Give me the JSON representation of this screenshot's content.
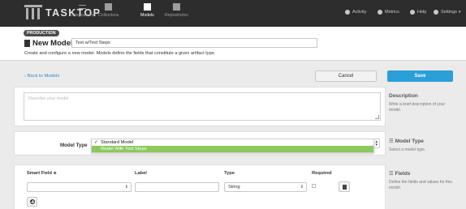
{
  "brand": {
    "name": "TASKTOP"
  },
  "nav": {
    "items": [
      {
        "label": "Integrations"
      },
      {
        "label": "Collections"
      },
      {
        "label": "Models"
      },
      {
        "label": "Repositories"
      }
    ],
    "right": [
      {
        "label": "Activity",
        "icon": "bell-icon"
      },
      {
        "label": "Metrics",
        "icon": "dashboard-icon"
      },
      {
        "label": "Help",
        "icon": "help-icon"
      },
      {
        "label": "Settings",
        "icon": "gear-icon"
      }
    ]
  },
  "header": {
    "badge": "PRODUCTION",
    "title": "New Model",
    "name_value": "Test w/Test Steps",
    "subtitle": "Create and configure a new model. Models define the fields that constitute a given artifact type."
  },
  "actions": {
    "back": "Back to Models",
    "cancel": "Cancel",
    "save": "Save"
  },
  "description": {
    "placeholder": "Describe your model",
    "side_title": "Description",
    "side_text": "Write a brief description of your model."
  },
  "model_type": {
    "label": "Model Type",
    "options": [
      "Standard Model",
      "Model With Test Steps"
    ],
    "checked": "Standard Model",
    "highlighted": "Model With Test Steps",
    "side_title": "Model Type",
    "side_text": "Select a model type."
  },
  "fields": {
    "columns": [
      "Smart Field",
      "Label",
      "Type",
      "Required"
    ],
    "row": {
      "smart_field": "",
      "label": "",
      "type": "String"
    },
    "side_title": "Fields",
    "side_text": "Define the fields and values for this model."
  },
  "colors": {
    "topbar": "#2d2d2d",
    "accent": "#2a9fd8",
    "link": "#3a88c5",
    "highlight": "#8cc85c"
  }
}
